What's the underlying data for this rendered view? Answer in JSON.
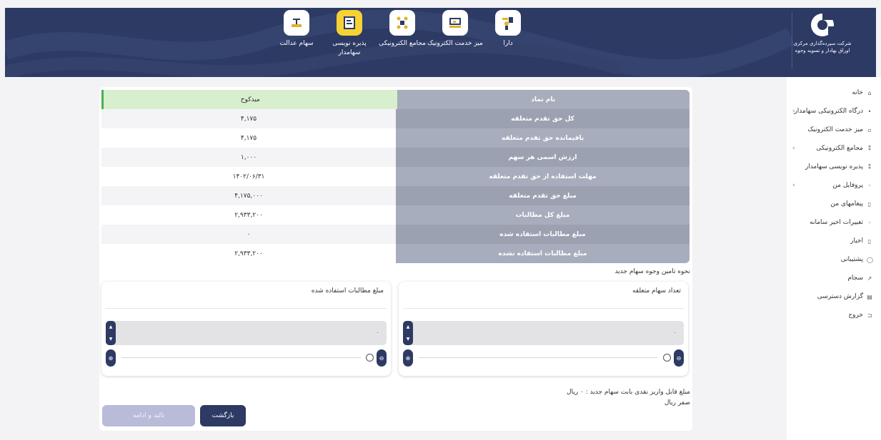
{
  "header": {
    "logo_text_1": "شرکت سپرده‌گذاری مرکزی",
    "logo_text_2": "اوراق بهادار و تسویه وجوه",
    "nav": [
      {
        "label": "دارا",
        "icon": "building-person-icon"
      },
      {
        "label": "میز خدمت الکترونیک",
        "icon": "service-desk-icon"
      },
      {
        "label": "مجامع الکترونیکی",
        "icon": "assembly-meeting-icon"
      },
      {
        "label": "پذیره نویسی سهامدار",
        "icon": "subscription-document-icon"
      },
      {
        "label": "سهام عدالت",
        "icon": "justice-shares-icon"
      }
    ]
  },
  "sidebar": {
    "items": [
      {
        "label": "خانه",
        "icon": "home-icon"
      },
      {
        "label": "درگاه الکترونیکی سهامدار",
        "icon": "portal-icon"
      },
      {
        "label": "میز خدمت الکترونیک",
        "icon": "desk-icon"
      },
      {
        "label": "مجامع الکترونیکی",
        "icon": "meeting-icon"
      },
      {
        "label": "پذیره نویسی سهامدار",
        "icon": "subscription-icon"
      },
      {
        "label": "پروفایل من",
        "icon": "user-icon"
      },
      {
        "label": "پیغامهای من",
        "icon": "message-icon"
      },
      {
        "label": "تغییرات اخیر سامانه",
        "icon": "changes-icon"
      },
      {
        "label": "اخبار",
        "icon": "news-icon"
      },
      {
        "label": "پشتیبانی",
        "icon": "support-icon"
      },
      {
        "label": "سجام",
        "icon": "sejam-icon"
      },
      {
        "label": "گزارش دسترسی",
        "icon": "report-icon"
      },
      {
        "label": "خروج",
        "icon": "logout-icon"
      }
    ]
  },
  "table": {
    "rows": [
      {
        "label": "نام نماد",
        "value": "میدکوح"
      },
      {
        "label": "کل حق تقدم متعلقه",
        "value": "۴,۱۷۵"
      },
      {
        "label": "باقیمانده حق تقدم متعلقه",
        "value": "۴,۱۷۵"
      },
      {
        "label": "ارزش اسمی هر سهم",
        "value": "۱,۰۰۰"
      },
      {
        "label": "مهلت استفاده از حق تقدم متعلقه",
        "value": "۱۴۰۲/۰۶/۳۱"
      },
      {
        "label": "مبلغ حق تقدم متعلقه",
        "value": "۴,۱۷۵,۰۰۰"
      },
      {
        "label": "مبلغ کل مطالبات",
        "value": "۲,۹۳۳,۲۰۰"
      },
      {
        "label": "مبلغ مطالبات استفاده شده",
        "value": "۰"
      },
      {
        "label": "مبلغ مطالبات استفاده نشده",
        "value": "۲,۹۳۳,۲۰۰"
      }
    ]
  },
  "funding": {
    "title": "نحوه تامین وجوه سهام جدید",
    "shares_panel_title": "تعداد سهام متعلقه",
    "claims_panel_title": "مبلغ مطالبات استفاده شده",
    "shares_value": "۰",
    "claims_value": "۰",
    "shares_slider_level": 0,
    "claims_slider_level": 0
  },
  "summary": {
    "payable_text": "مبلغ قابل واریز نقدی بابت سهام جدید : ۰ ریال",
    "payable_words": "صفر ریال"
  },
  "buttons": {
    "back": "بازگشت",
    "confirm": "تائید و ادامه"
  },
  "colors": {
    "header_bg": "#2c3a64",
    "accent_yellow": "#f6d233",
    "label_bg": "#a8adbd",
    "highlight_green": "#d7efcd"
  }
}
